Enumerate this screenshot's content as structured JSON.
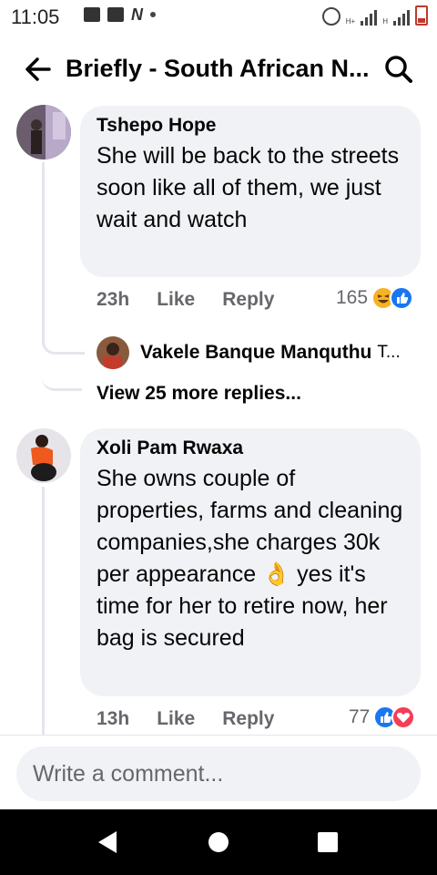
{
  "status_bar": {
    "time": "11:05",
    "left_icons": [
      "image-icon",
      "news-icon",
      "n-icon",
      "dot-icon"
    ],
    "right_icons": [
      "alarm-icon",
      "signal-icon",
      "signal-icon",
      "battery-icon"
    ],
    "network_tags": [
      "H+",
      "H"
    ]
  },
  "header": {
    "title": "Briefly - South African N...",
    "back_icon": "arrow-left-icon",
    "search_icon": "search-icon"
  },
  "comments": [
    {
      "author": "Tshepo Hope",
      "text": "She will be back to the streets soon like all of them, we just wait and watch",
      "time": "23h",
      "like_label": "Like",
      "reply_label": "Reply",
      "reaction_count": "165",
      "reactions": [
        "haha",
        "like"
      ],
      "replies_preview": {
        "name": "Vakele Banque Manquthu",
        "snippet": "T..."
      },
      "more_replies": "View 25 more replies..."
    },
    {
      "author": "Xoli Pam Rwaxa",
      "text_part1": "She owns couple of properties, farms and cleaning companies,she charges 30k per appearance",
      "emoji": "👌",
      "text_part2": " yes it's time for her to retire now, her bag is secured",
      "time": "13h",
      "like_label": "Like",
      "reply_label": "Reply",
      "reaction_count": "77",
      "reactions": [
        "like",
        "love"
      ]
    }
  ],
  "composer": {
    "placeholder": "Write a comment..."
  },
  "nav": [
    "back-icon",
    "home-icon",
    "recents-icon"
  ],
  "colors": {
    "bubble": "#f0f2f5",
    "meta_text": "#65676b",
    "like_blue": "#1877f2",
    "love_red": "#f33e58",
    "haha_yellow": "#f7b125"
  }
}
